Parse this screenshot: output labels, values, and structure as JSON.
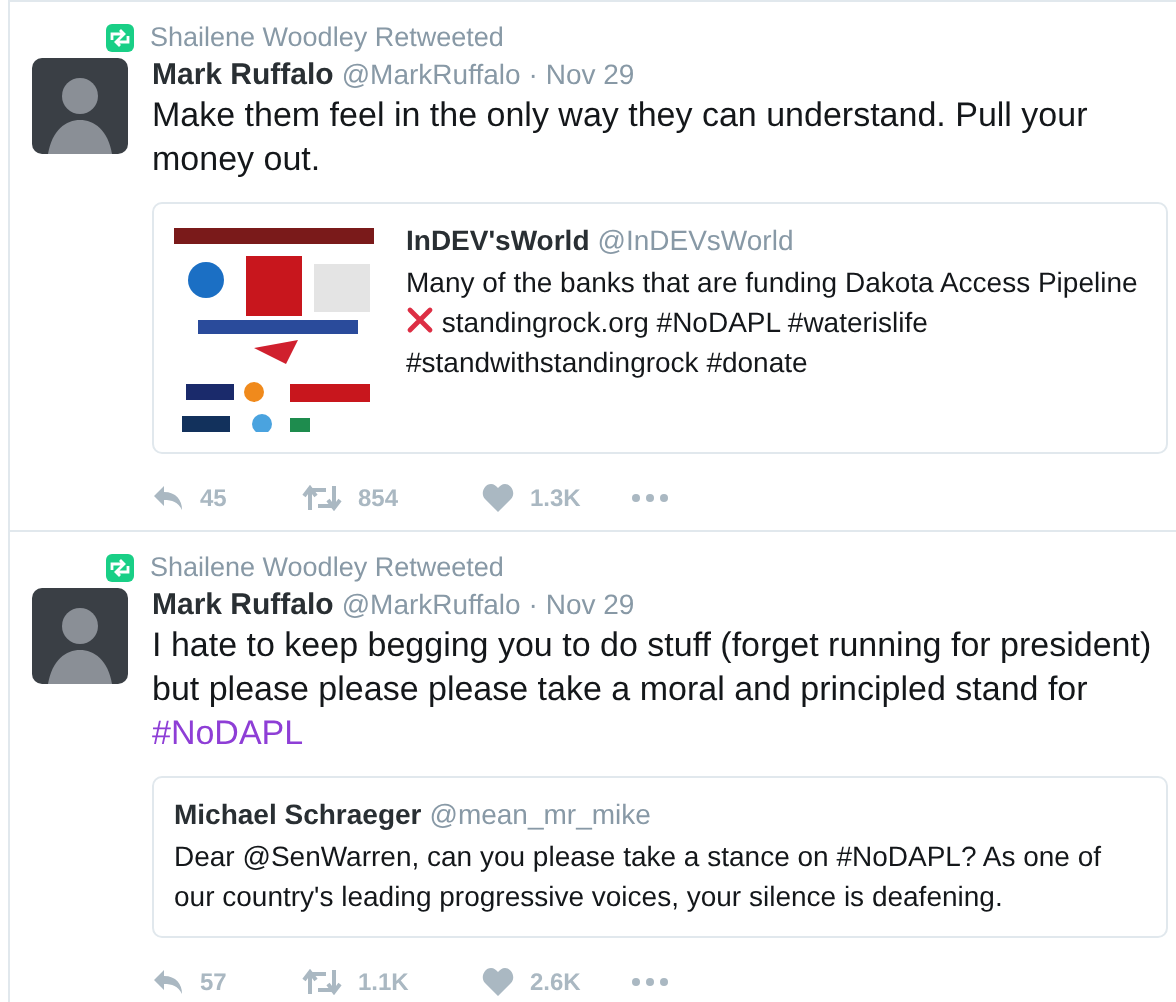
{
  "tweets": [
    {
      "retweeted_by": "Shailene Woodley Retweeted",
      "name": "Mark Ruffalo",
      "handle": "@MarkRuffalo",
      "date": "· Nov 29",
      "body": [
        {
          "kind": "text",
          "text": "Make them feel in the only way they can understand. Pull your money out."
        }
      ],
      "quote": {
        "kind": "picture",
        "name": "InDEV'sWorld",
        "handle": "@InDEVsWorld",
        "body": [
          {
            "kind": "text",
            "text": "Many of the banks that are funding Dakota Access Pipeline"
          },
          {
            "kind": "cross"
          },
          {
            "kind": "text",
            "text": "standingrock.org #NoDAPL #waterislife #standwithstandingrock #donate"
          }
        ]
      },
      "replies": "45",
      "retweets": "854",
      "likes": "1.3K"
    },
    {
      "retweeted_by": "Shailene Woodley Retweeted",
      "name": "Mark Ruffalo",
      "handle": "@MarkRuffalo",
      "date": "· Nov 29",
      "body": [
        {
          "kind": "text",
          "text": "I hate to keep begging you to do stuff (forget running for president) but please please please take a moral and principled stand for"
        },
        {
          "kind": "hashtag",
          "text": "#NoDAPL"
        }
      ],
      "quote": {
        "kind": "text",
        "name": "Michael Schraeger",
        "handle": "@mean_mr_mike",
        "body": [
          {
            "kind": "text",
            "text": "Dear @SenWarren, can you please take a stance on #NoDAPL? As one of our country's leading progressive voices, your silence is deafening."
          }
        ]
      },
      "replies": "57",
      "retweets": "1.1K",
      "likes": "2.6K"
    }
  ]
}
